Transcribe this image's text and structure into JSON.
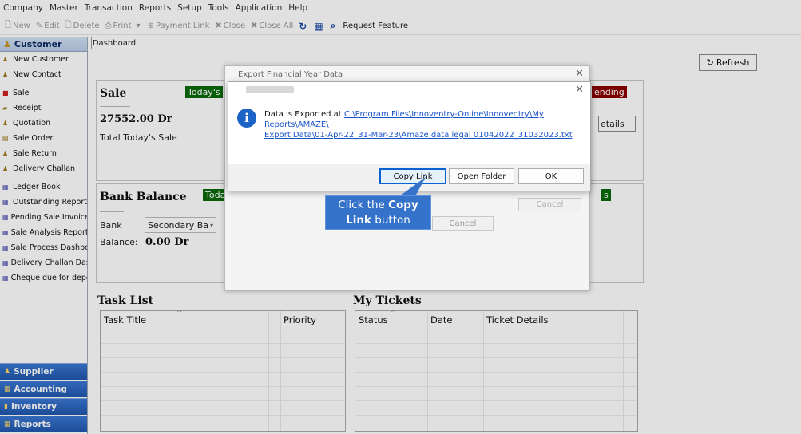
{
  "menubar": [
    "Company",
    "Master",
    "Transaction",
    "Reports",
    "Setup",
    "Tools",
    "Application",
    "Help"
  ],
  "toolbar": {
    "new": "New",
    "edit": "Edit",
    "delete": "Delete",
    "print": "Print",
    "payment_link": "Payment Link",
    "close": "Close",
    "close_all": "Close All",
    "request_feature": "Request Feature"
  },
  "sidebar": {
    "header": "Customer",
    "group1": [
      "New Customer",
      "New Contact"
    ],
    "group2": [
      "Sale",
      "Receipt",
      "Quotation",
      "Sale Order",
      "Sale Return",
      "Delivery Challan"
    ],
    "group3": [
      "Ledger Book",
      "Outstanding Report",
      "Pending Sale Invoices",
      "Sale Analysis Report",
      "Sale Process Dashboa",
      "Delivery Challan Dashl",
      "Cheque due for depos"
    ],
    "bottom": [
      "Supplier",
      "Accounting",
      "Inventory",
      "Reports"
    ]
  },
  "tab": "Dashboard",
  "refresh": "Refresh",
  "sale": {
    "title": "Sale",
    "tag": "Today's",
    "amount": "27552.00 Dr",
    "caption": "Total Today's Sale",
    "pending_tag": "ending",
    "details_btn": "etails"
  },
  "bank": {
    "title": "Bank Balance",
    "tag": "Toda",
    "tag2": "s",
    "bank_label": "Bank",
    "bank_value": "Secondary Ba",
    "balance_label": "Balance:",
    "balance_value": "0.00 Dr"
  },
  "tasks": {
    "title": "Task List",
    "columns": [
      "Task Title",
      "Priority"
    ]
  },
  "tickets": {
    "title": "My Tickets",
    "columns": [
      "Status",
      "Date",
      "Ticket Details"
    ]
  },
  "export_dialog": {
    "title": "Export Financial Year Data",
    "cancel": "Cancel",
    "cancel2": "Cancel"
  },
  "message": {
    "prefix": "Data is Exported at ",
    "path_line1": "C:\\Program Files\\Innoventry-Online\\Innoventry\\My Reports\\AMAZE\\",
    "path_line2": "Export Data\\01-Apr-22_31-Mar-23\\Amaze data legal 01042022_31032023.txt",
    "copy_link": "Copy Link",
    "open_folder": "Open Folder",
    "ok": "OK"
  },
  "callout": {
    "line1_pre": "Click the ",
    "line1_bold": "Copy",
    "line2_bold": "Link",
    "line2_post": " button"
  }
}
